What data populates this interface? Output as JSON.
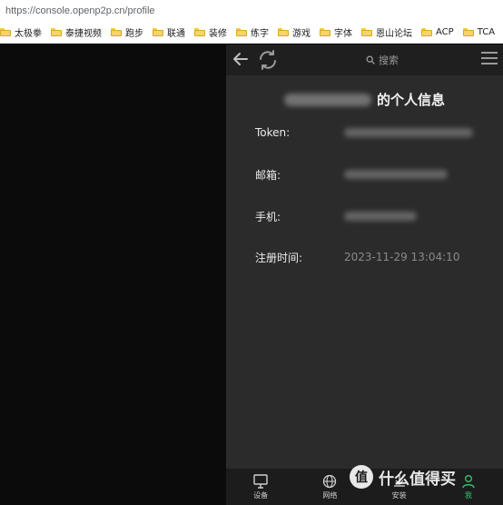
{
  "browser": {
    "url": "https://console.openp2p.cn/profile",
    "bookmarks": [
      "太极拳",
      "泰捷视频",
      "跑步",
      "联通",
      "装修",
      "练字",
      "游戏",
      "字体",
      "恩山论坛",
      "ACP",
      "TCA"
    ]
  },
  "header": {
    "search_label": "搜索",
    "icons": [
      "back-arrow-icon",
      "refresh-icon",
      "search-icon",
      "menu-icon"
    ]
  },
  "profile": {
    "title": "的个人信息",
    "fields": [
      {
        "label": "Token:",
        "value": ""
      },
      {
        "label": "邮箱:",
        "value": ""
      },
      {
        "label": "手机:",
        "value": ""
      },
      {
        "label": "注册时间:",
        "value": "2023-11-29 13:04:10"
      }
    ]
  },
  "nav": {
    "items": [
      {
        "label": "设备",
        "icon": "monitor-icon",
        "active": false
      },
      {
        "label": "网络",
        "icon": "globe-icon",
        "active": false
      },
      {
        "label": "安装",
        "icon": "install-icon",
        "active": false
      },
      {
        "label": "我",
        "icon": "user-icon",
        "active": true
      }
    ]
  },
  "watermark": {
    "badge": "值",
    "text": "什么值得买"
  },
  "colors": {
    "accent": "#32c36c",
    "app_bg": "#2b2b2b",
    "header_bg": "#1f1f1f"
  }
}
